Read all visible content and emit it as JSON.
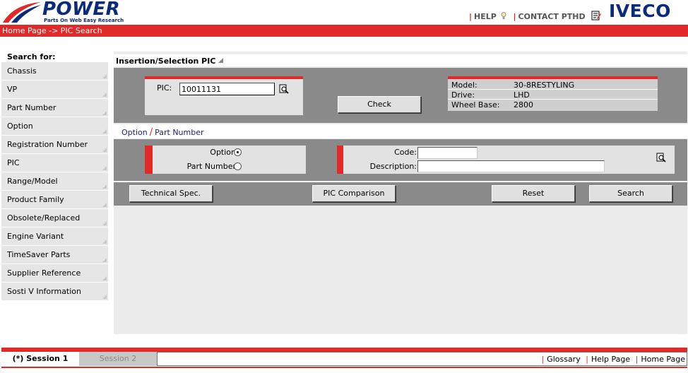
{
  "header": {
    "logo_text": "POWER",
    "logo_subtitle": "Parts On Web Easy Research",
    "help_label": "HELP",
    "contact_label": "CONTACT PTHD",
    "brand": "IVECO",
    "breadcrumb": "Home Page -> PIC Search"
  },
  "sidebar": {
    "title": "Search for:",
    "items": [
      {
        "label": "Chassis"
      },
      {
        "label": "VP"
      },
      {
        "label": "Part Number"
      },
      {
        "label": "Option"
      },
      {
        "label": "Registration Number"
      },
      {
        "label": "PIC"
      },
      {
        "label": "Range/Model"
      },
      {
        "label": "Product Family"
      },
      {
        "label": "Obsolete/Replaced"
      },
      {
        "label": "Engine Variant"
      },
      {
        "label": "TimeSaver Parts"
      },
      {
        "label": "Supplier Reference"
      },
      {
        "label": "Sosti V Information"
      }
    ]
  },
  "main": {
    "section_title": "Insertion/Selection PIC",
    "pic_label": "PIC:",
    "pic_value": "10011131",
    "check_button": "Check",
    "info": {
      "model_label": "Model:",
      "model_value": "30-8RESTYLING",
      "drive_label": "Drive:",
      "drive_value": "LHD",
      "wheelbase_label": "Wheel Base:",
      "wheelbase_value": "2800"
    },
    "tabs": {
      "option": "Option",
      "part_number": "Part Number"
    },
    "radio_option_label": "Option",
    "radio_partnumber_label": "Part Number",
    "selected_radio": "Option",
    "code_label": "Code:",
    "description_label": "Description:",
    "code_value": "",
    "description_value": "",
    "buttons": {
      "technical_spec": "Technical Spec.",
      "pic_comparison": "PIC Comparison",
      "reset": "Reset",
      "search": "Search"
    }
  },
  "footer": {
    "session1": "(*) Session 1",
    "session2": "Session 2",
    "glossary": "Glossary",
    "help_page": "Help Page",
    "home_page": "Home Page"
  },
  "colors": {
    "accent_red": "#e02a2a",
    "brand_blue": "#0b2a78",
    "panel_grey": "#8a8a8a"
  }
}
